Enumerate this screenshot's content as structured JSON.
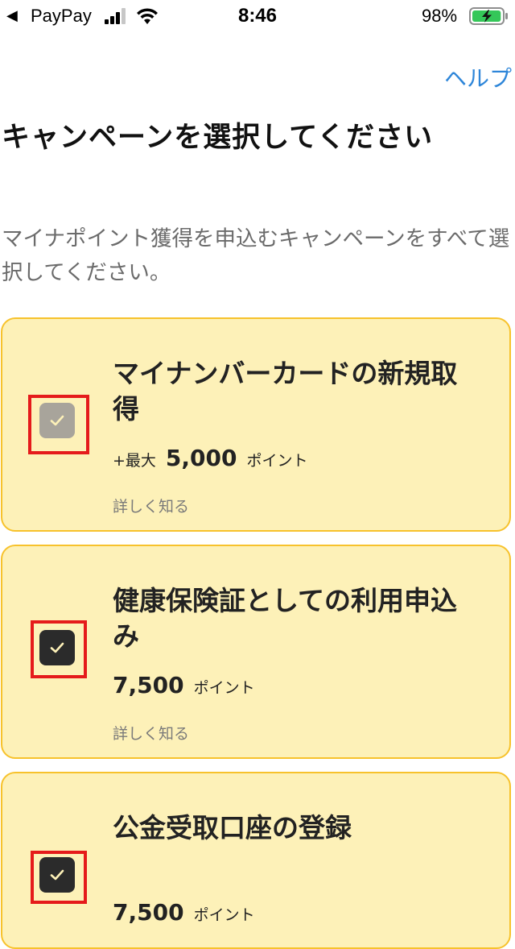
{
  "status_bar": {
    "back_glyph": "◀",
    "carrier": "PayPay",
    "time": "8:46",
    "battery_percent": "98%",
    "signal_bars": 3,
    "battery_level": 0.98,
    "battery_charging": true,
    "battery_color": "#34c759"
  },
  "header": {
    "help_label": "ヘルプ",
    "help_color": "#2e86d9"
  },
  "page": {
    "title": "キャンペーンを選択してください",
    "instruction": "マイナポイント獲得を申込むキャンペーンをすべて選択してください。"
  },
  "campaigns": [
    {
      "title": "マイナンバーカードの新規取得",
      "points_prefix": "+最大",
      "points_value": "5,000",
      "points_unit": "ポイント",
      "details_label": "詳しく知る",
      "checked": true,
      "disabled": true
    },
    {
      "title": "健康保険証としての利用申込み",
      "points_prefix": "",
      "points_value": "7,500",
      "points_unit": "ポイント",
      "details_label": "詳しく知る",
      "checked": true,
      "disabled": false
    },
    {
      "title": "公金受取口座の登録",
      "points_prefix": "",
      "points_value": "7,500",
      "points_unit": "ポイント",
      "checked": true,
      "disabled": false
    }
  ],
  "colors": {
    "card_background": "#fdf1b8",
    "card_border": "#f7c22c",
    "highlight": "#e51b1b",
    "checkbox_disabled": "#a8a49b",
    "checkbox_checked": "#2b2b2b"
  },
  "icons": {
    "back": "back-arrow-icon",
    "signal": "cellular-signal-icon",
    "wifi": "wifi-icon",
    "battery": "battery-charging-icon",
    "checkmark": "checkmark-icon"
  }
}
